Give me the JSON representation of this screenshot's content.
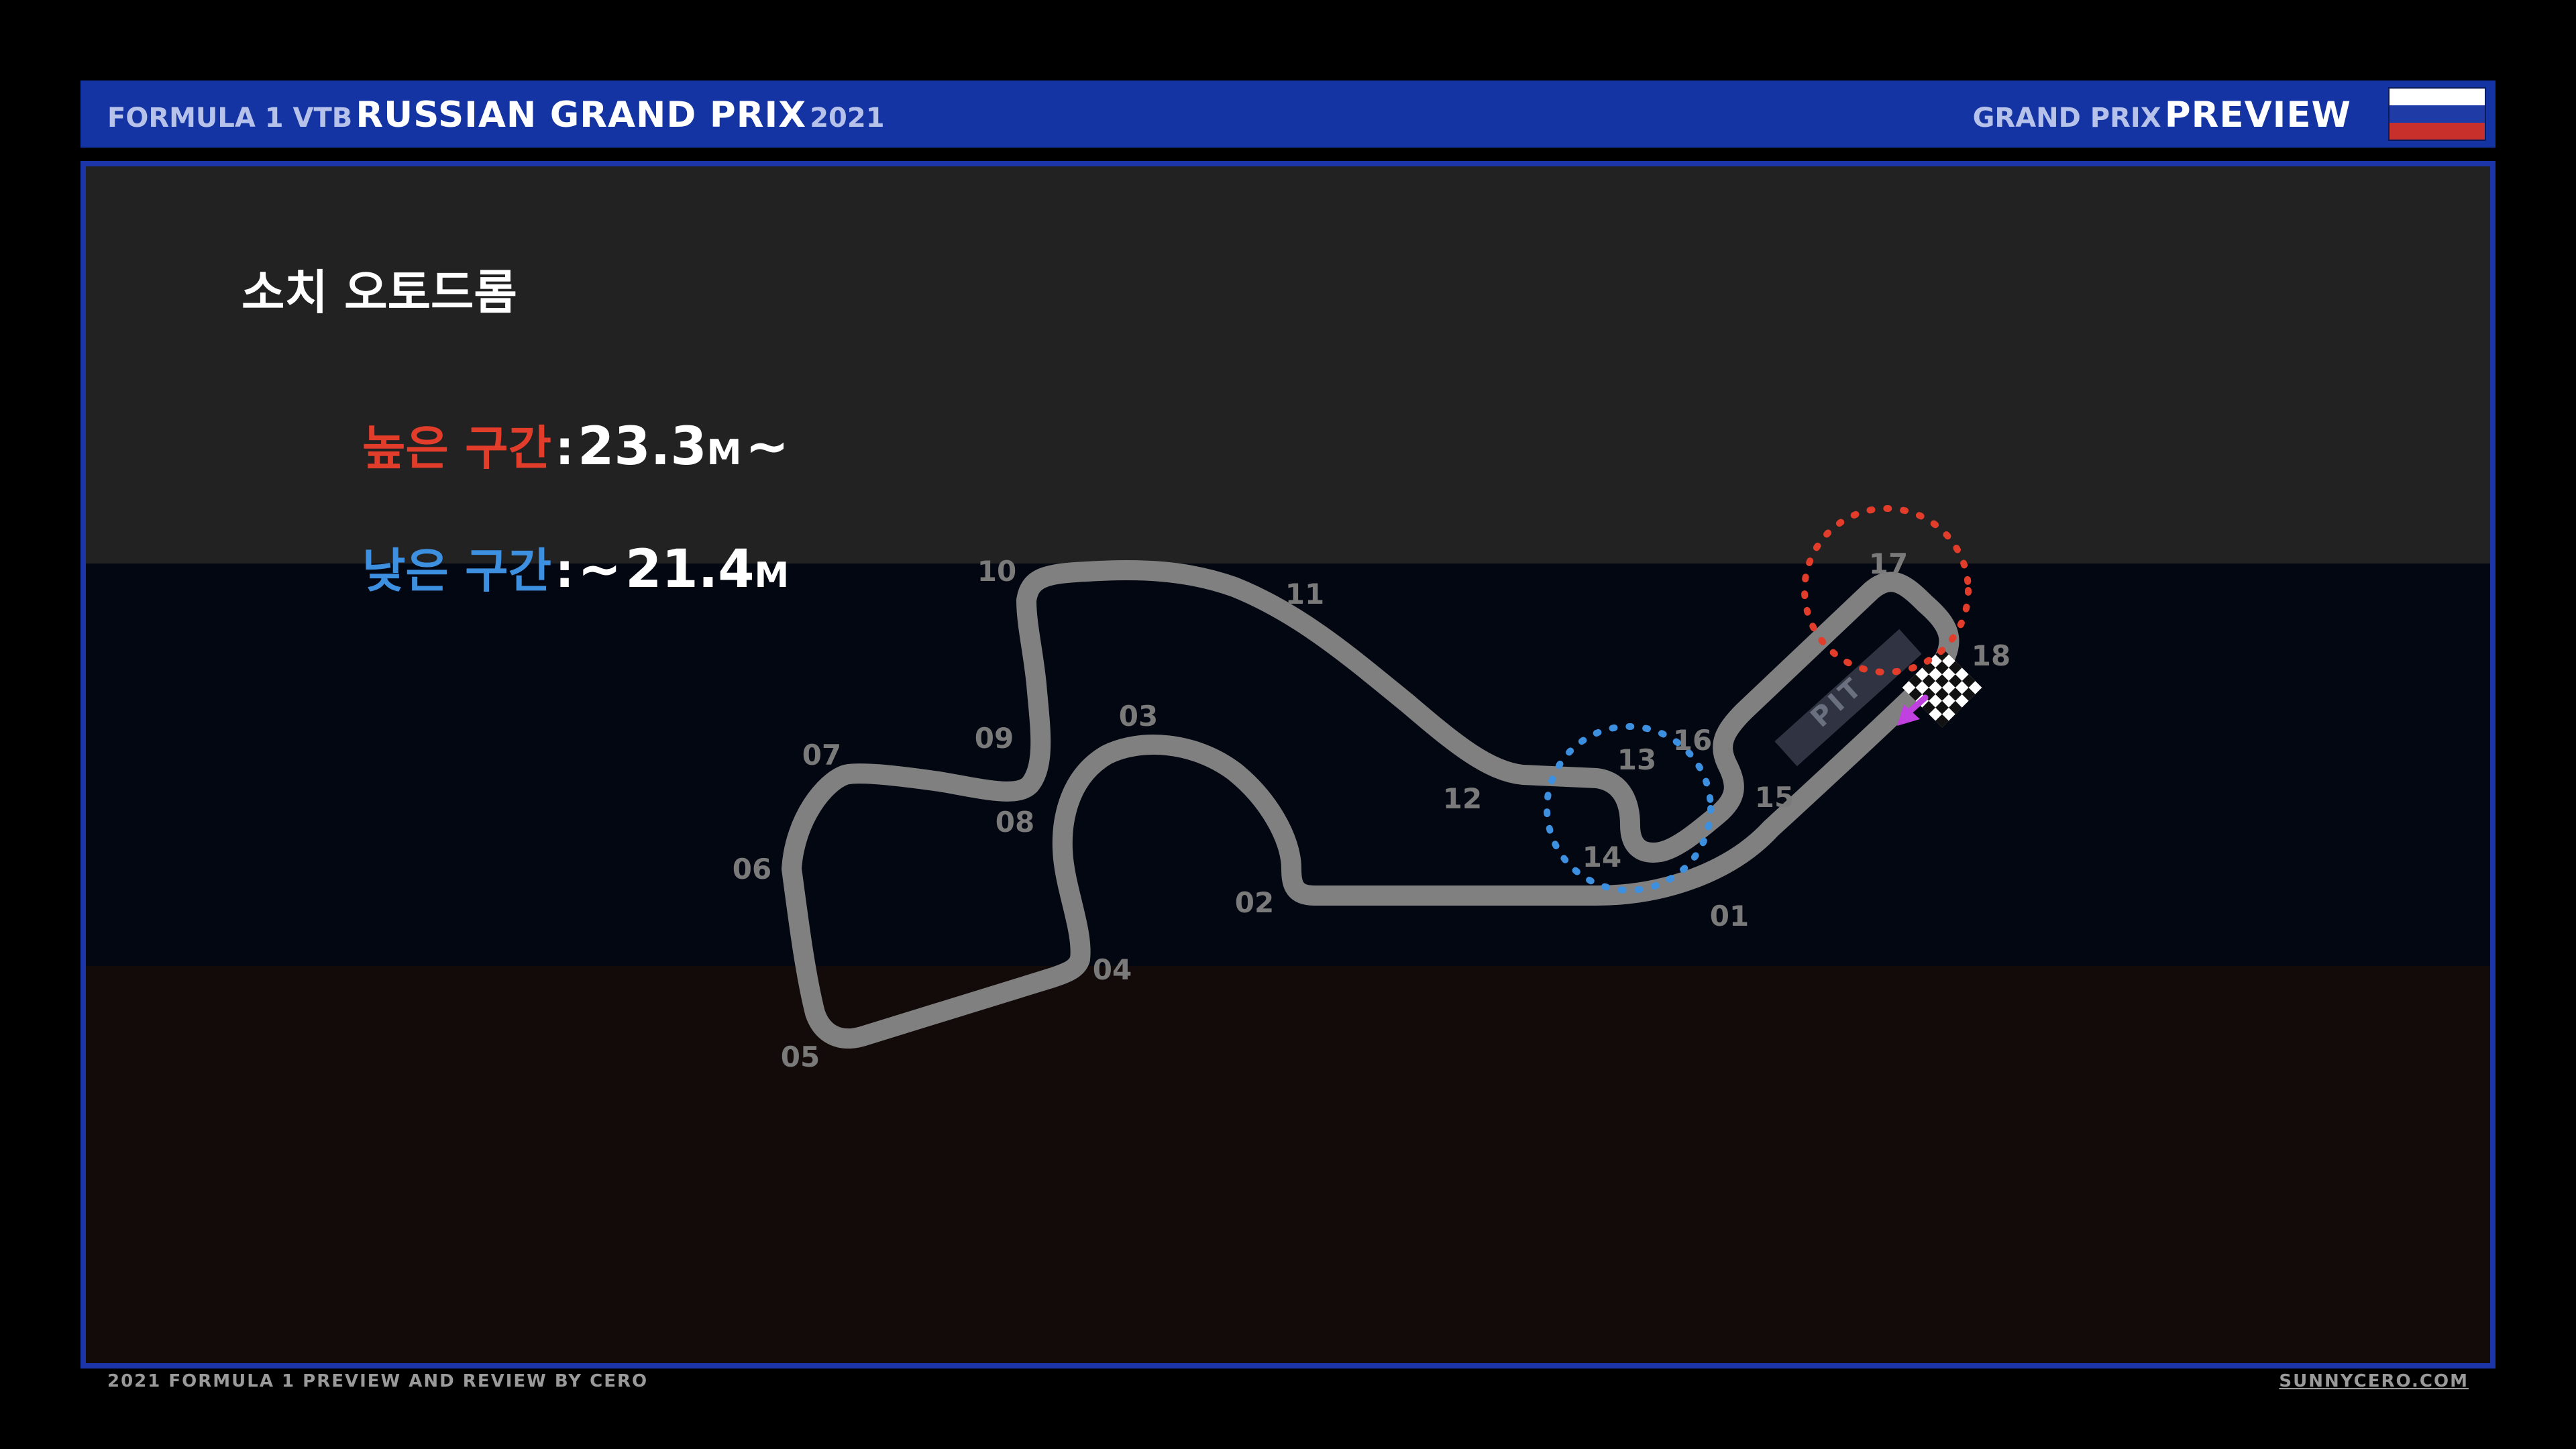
{
  "header": {
    "event_prefix": "FORMULA 1 VTB",
    "event_name": "RUSSIAN GRAND PRIX",
    "year": "2021",
    "section_prefix": "GRAND PRIX",
    "section_name": "PREVIEW",
    "flag": [
      "#ffffff",
      "#1f3ca6",
      "#c8302c"
    ]
  },
  "content": {
    "title": "소치 오토드롬",
    "high_section": {
      "label": "높은 구간",
      "separator": ":",
      "value": "23.3",
      "unit": "M",
      "suffix": "~",
      "color": "#e23c2a"
    },
    "low_section": {
      "label": "낮은 구간",
      "separator": ":",
      "prefix": "~",
      "value": "21.4",
      "unit": "M",
      "color": "#3d8fe0"
    },
    "band_colors": [
      "#222222",
      "#030712",
      "#130a0a"
    ]
  },
  "track": {
    "pit_label": "PIT",
    "track_color": "#808080",
    "turns": [
      "01",
      "02",
      "03",
      "04",
      "05",
      "06",
      "07",
      "08",
      "09",
      "10",
      "11",
      "12",
      "13",
      "14",
      "15",
      "16",
      "17",
      "18"
    ],
    "highlights": [
      {
        "turn": "17",
        "zone": "high",
        "color": "#e23c2a"
      },
      {
        "turn": "14",
        "zone": "low",
        "color": "#3d8fe0"
      }
    ],
    "direction_arrow_color": "#c040e0"
  },
  "footer": {
    "left": "2021 FORMULA 1 PREVIEW AND REVIEW BY CERO",
    "right": "SUNNYCERO.COM"
  }
}
